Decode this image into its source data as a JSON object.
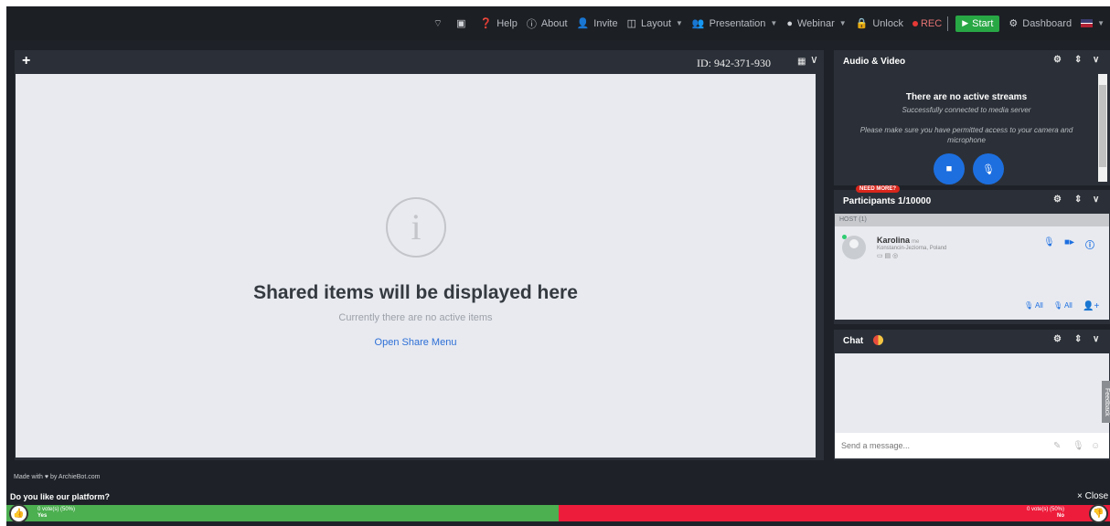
{
  "topbar": {
    "items": [
      {
        "icon": "wifi-icon",
        "glyph": "⌔",
        "label": ""
      },
      {
        "icon": "screen-icon",
        "glyph": "▣",
        "label": ""
      },
      {
        "icon": "help-icon",
        "glyph": "❓",
        "label": "Help"
      },
      {
        "icon": "info-icon",
        "glyph": "ⓘ",
        "label": "About"
      },
      {
        "icon": "invite-icon",
        "glyph": "👤",
        "label": "Invite"
      },
      {
        "icon": "layout-icon",
        "glyph": "◫",
        "label": "Layout"
      },
      {
        "icon": "presentation-icon",
        "glyph": "👥",
        "label": "Presentation"
      },
      {
        "icon": "webinar-icon",
        "glyph": "●",
        "label": "Webinar"
      },
      {
        "icon": "lock-icon",
        "glyph": "🔒",
        "label": "Unlock"
      }
    ],
    "rec_label": "REC",
    "start_label": "Start",
    "dashboard_label": "Dashboard"
  },
  "shared": {
    "meeting_id": "ID: 942-371-930",
    "title": "Shared items will be displayed here",
    "subtitle": "Currently there are no active items",
    "share_link": "Open Share Menu"
  },
  "audio_video": {
    "title": "Audio & Video",
    "no_streams": "There are no active streams",
    "connected": "Successfully connected to media server",
    "note": "Please make sure you have permitted access to your camera and microphone"
  },
  "participants": {
    "badge": "NEED MORE?",
    "title": "Participants 1/10000",
    "host_label": "HOST",
    "host_count": "(1)",
    "name": "Karolina",
    "me_tag": "me",
    "location": "Konstancin-Jeziorna, Poland",
    "mute_all": "All",
    "unmute_all": "All"
  },
  "chat": {
    "title": "Chat",
    "placeholder": "Send a message..."
  },
  "feedback_label": "Feedback",
  "footer": {
    "made_with_prefix": "Made with",
    "made_with_suffix": "by ArchieBot.com"
  },
  "poll": {
    "question": "Do you like our platform?",
    "close_label": "× Close",
    "yes_votes": "0 vote(s) (50%)",
    "yes_label": "Yes",
    "no_votes": "0 vote(s) (50%)",
    "no_label": "No",
    "yes_share": 0.5,
    "no_share": 0.5
  },
  "colors": {
    "accent_blue": "#1d6fe0",
    "start_green": "#28a745",
    "yes_green": "#4caf50",
    "no_red": "#ee1c3b",
    "rec_red": "#e53935"
  }
}
